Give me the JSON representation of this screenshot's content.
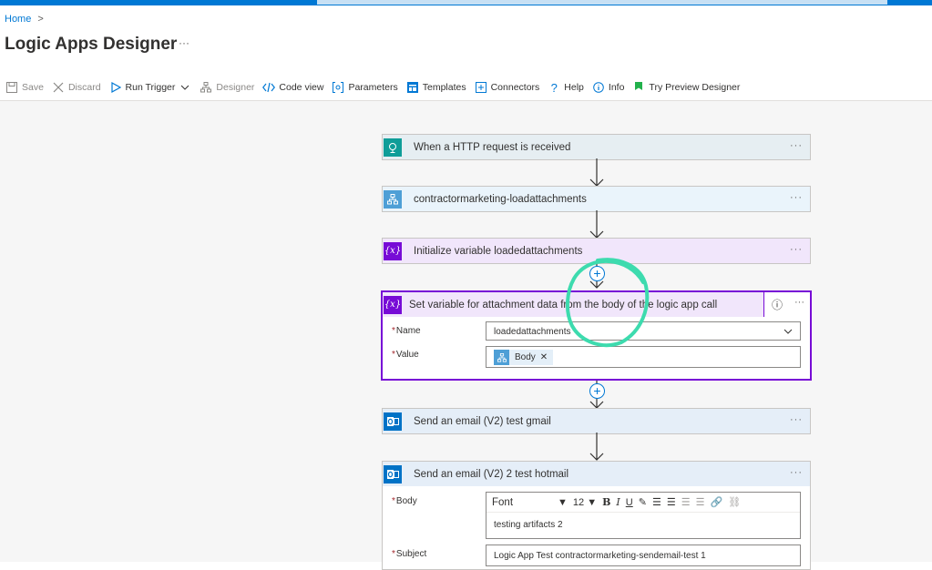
{
  "breadcrumb": {
    "home": "Home",
    "sep": ">"
  },
  "page": {
    "title": "Logic Apps Designer",
    "more": "···"
  },
  "toolbar": {
    "save": "Save",
    "discard": "Discard",
    "run_trigger": "Run Trigger",
    "designer": "Designer",
    "code_view": "Code view",
    "parameters": "Parameters",
    "templates": "Templates",
    "connectors": "Connectors",
    "help": "Help",
    "info": "Info",
    "try_preview": "Try Preview Designer"
  },
  "steps": {
    "trigger": {
      "label": "When a HTTP request is received",
      "color": "#0f9d98",
      "icon": "http-trigger-icon"
    },
    "workflow": {
      "label": "contractormarketing-loadattachments",
      "color": "#4e9fd6",
      "icon": "workflow-icon"
    },
    "init_var": {
      "label": "Initialize variable loadedattachments",
      "color": "#770bd6",
      "icon": "variable-icon"
    },
    "set_var": {
      "label": "Set variable for attachment data from the body of the logic app call",
      "color": "#770bd6",
      "icon": "variable-icon",
      "name_label": "Name",
      "name_value": "loadedattachments",
      "value_label": "Value",
      "value_token": "Body"
    },
    "email1": {
      "label": "Send an email (V2) test gmail",
      "color": "#0072c6",
      "icon": "outlook-icon"
    },
    "email2": {
      "label": "Send an email (V2) 2 test hotmail",
      "color": "#0072c6",
      "icon": "outlook-icon",
      "body_label": "Body",
      "font": "Font",
      "font_size": "12",
      "body_text": "testing artifacts 2",
      "subject_label": "Subject",
      "subject_value": "Logic App Test contractormarketing-sendemail-test 1"
    }
  },
  "colors": {
    "accent": "#0078d4",
    "highlight": "#3ddbae"
  }
}
